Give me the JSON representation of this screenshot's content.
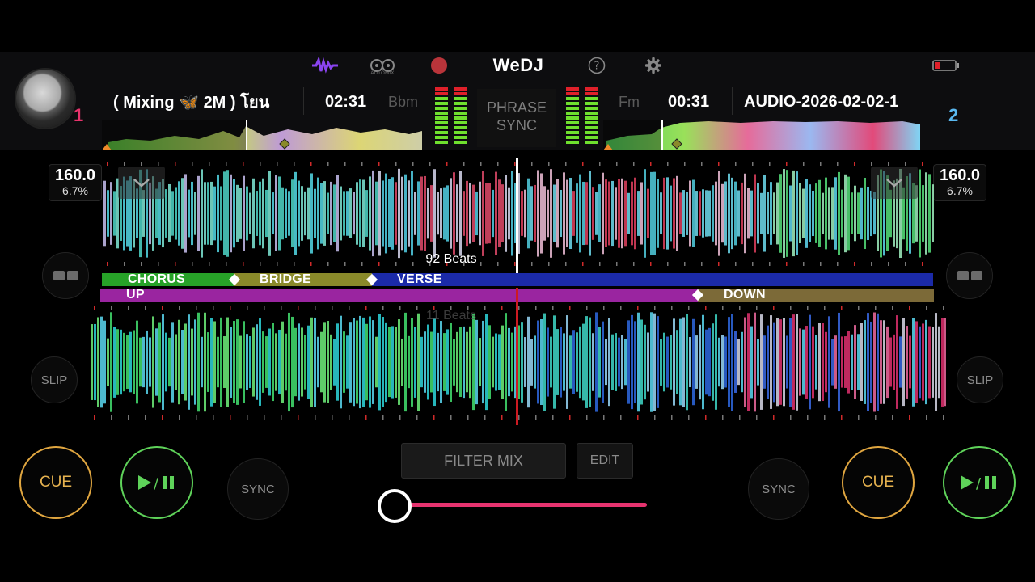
{
  "toolbar": {
    "app_title": "WeDJ",
    "automix_label": "AUTOMIX",
    "colors": {
      "record": "#b9343a",
      "wave_icon": "#8a44f0",
      "battery_low": "#e0202a"
    }
  },
  "deck1": {
    "number": "1",
    "number_color": "#e8336c",
    "track_title": "( Mixing 🦋 2M ) โยน",
    "time": "02:31",
    "key": "Bbm",
    "bpm": "160.0",
    "pitch": "6.7%",
    "beats_label": "92 Beats",
    "cue_label": "CUE",
    "sync_label": "SYNC",
    "slip_label": "SLIP"
  },
  "deck2": {
    "number": "2",
    "number_color": "#5ab8f0",
    "track_title": "AUDIO-2026-02-02-1",
    "time": "00:31",
    "key": "Fm",
    "bpm": "160.0",
    "pitch": "6.7%",
    "beats_label": "11 Beats",
    "cue_label": "CUE",
    "sync_label": "SYNC",
    "slip_label": "SLIP"
  },
  "phrase_sync": {
    "line1": "PHRASE",
    "line2": "SYNC"
  },
  "phrases_deck1": [
    {
      "label": "CHORUS",
      "color": "#27a228"
    },
    {
      "label": "BRIDGE",
      "color": "#8a8a2a"
    },
    {
      "label": "VERSE",
      "color": "#1b2aa8"
    }
  ],
  "phrases_deck2": [
    {
      "label": "UP",
      "color": "#9a25a0"
    },
    {
      "label": "DOWN",
      "color": "#7c6a38"
    }
  ],
  "mixer": {
    "filter_mix_label": "FILTER MIX",
    "edit_label": "EDIT",
    "slider_color": "#e6336f"
  },
  "colors": {
    "cue": "#e0a640",
    "play": "#5fd35a",
    "playhead": "#cc1a22"
  }
}
